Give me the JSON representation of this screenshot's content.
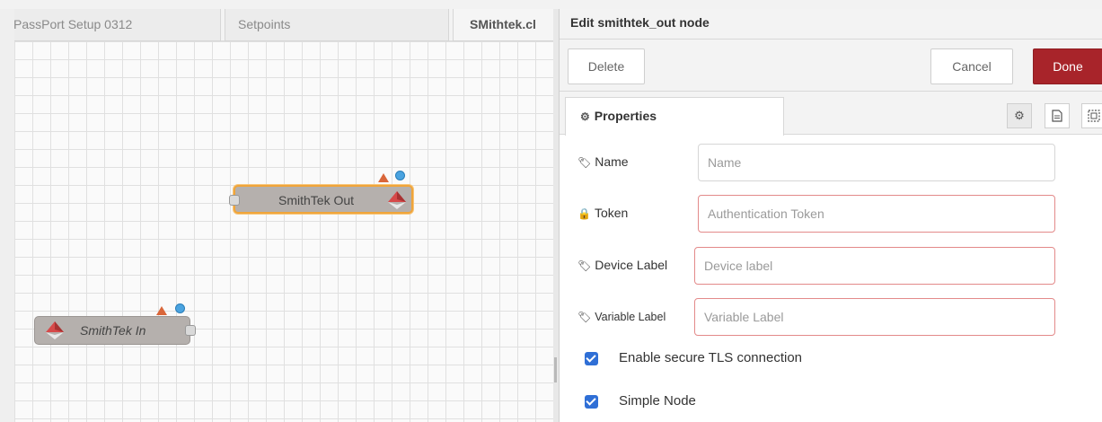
{
  "workspace": {
    "tabs": [
      {
        "label": "PassPort Setup 0312"
      },
      {
        "label": "Setpoints"
      },
      {
        "label": "SMithtek.cl"
      }
    ],
    "nodes": {
      "out": {
        "label": "SmithTek Out"
      },
      "in": {
        "label": "SmithTek In"
      }
    }
  },
  "editor": {
    "title": "Edit smithtek_out node",
    "buttons": {
      "delete": "Delete",
      "cancel": "Cancel",
      "done": "Done"
    },
    "tabs": {
      "properties": "Properties"
    },
    "fields": {
      "name": {
        "label": "Name",
        "placeholder": "Name",
        "value": ""
      },
      "token": {
        "label": "Token",
        "placeholder": "Authentication Token",
        "value": ""
      },
      "device_label": {
        "label": "Device Label",
        "placeholder": "Device label",
        "value": ""
      },
      "variable_label": {
        "label": "Variable Label",
        "placeholder": "Variable Label",
        "value": ""
      }
    },
    "checkboxes": {
      "tls": {
        "label": "Enable secure TLS connection",
        "checked": true
      },
      "simple": {
        "label": "Simple Node",
        "checked": true
      }
    }
  },
  "colors": {
    "done_button": "#a8242a",
    "selected_node_outline": "#f0a53a",
    "node_body": "#b5b0ad",
    "status_triangle": "#d9663a",
    "status_dot": "#4aa3e0",
    "checkbox": "#2f6fd6",
    "invalid_border": "#e38a8a"
  }
}
